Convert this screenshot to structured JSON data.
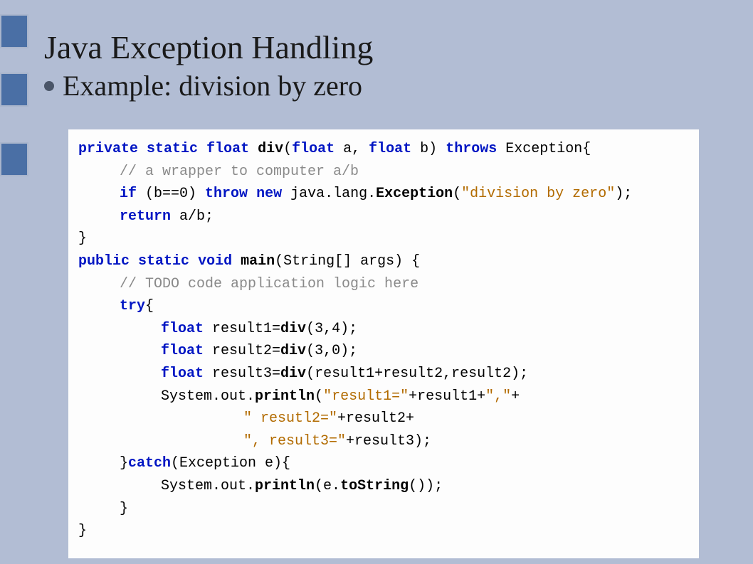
{
  "header": {
    "title": "Java Exception Handling",
    "subtitle": "Example: division by zero"
  },
  "code": {
    "kw": {
      "private": "private",
      "static": "static",
      "float": "float",
      "throws": "throws",
      "if": "if",
      "throw": "throw",
      "new": "new",
      "return": "return",
      "public": "public",
      "void": "void",
      "try": "try",
      "catch": "catch"
    },
    "fn": {
      "div": "div",
      "main": "main",
      "exception": "Exception",
      "println": "println",
      "toString": "toString"
    },
    "cm": {
      "wrapper": "// a wrapper to computer a/b",
      "todo": "// TODO code application logic here"
    },
    "str": {
      "divzero": "\"division by zero\"",
      "r1": "\"result1=\"",
      "comma": "\",\"",
      "r2": "\" resutl2=\"",
      "r3": "\", result3=\""
    },
    "txt": {
      "sig_div_open": "(",
      "a": " a, ",
      "b": " b) ",
      "exception_open": " Exception{",
      "cond": " (b==0) ",
      "javalang": " java.lang.",
      "open_paren": "(",
      "close_paren_semi": ");",
      "ret_expr": " a/b;",
      "brace_close": "}",
      "main_args": "(String[] args) {",
      "try_open": "{",
      "r1_expr": " result1=",
      "div34": "(3,4);",
      "r2_expr": " result2=",
      "div30": "(3,0);",
      "r3_expr": " result3=",
      "div_sum": "(result1+result2,result2);",
      "sout": "System.out.",
      "plus_r1": "+result1+",
      "plus": "+",
      "plus_r2": "+result2+",
      "plus_r3": "+result3);",
      "catch_sig": "(Exception e){",
      "e_dot": "(e.",
      "tostr_tail": "());"
    }
  }
}
